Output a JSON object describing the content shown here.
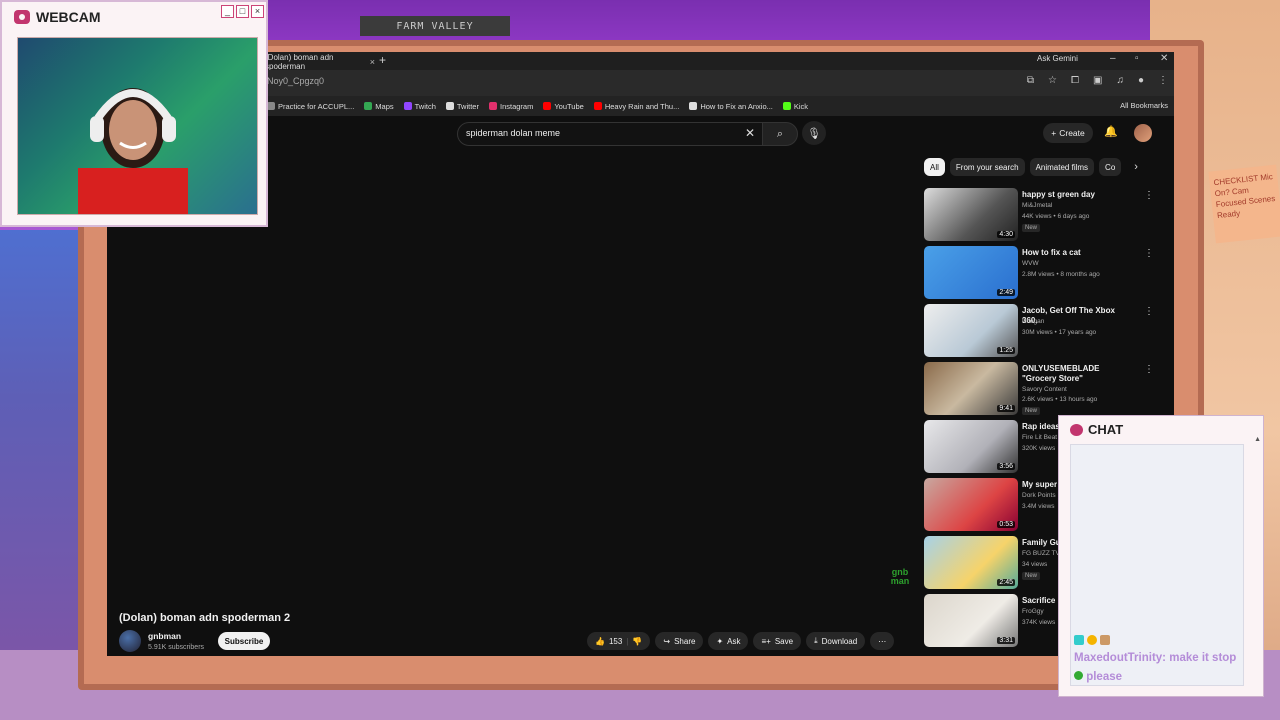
{
  "scene": {
    "shelf_sign": "FARM VALLEY",
    "sticky_note": "CHECKLIST Mic On? Cam Focused Scenes Ready"
  },
  "browser": {
    "tab_title": "(Dolan) boman adn spoderman",
    "tab_close": "×",
    "new_tab": "+",
    "ask_gemini": "Ask Gemini",
    "url": "Noy0_Cpgzq0",
    "bookmarks": [
      {
        "label": "Practice for ACCUPL...",
        "color": "#888888"
      },
      {
        "label": "Maps",
        "color": "#34a853"
      },
      {
        "label": "Twitch",
        "color": "#9146ff"
      },
      {
        "label": "Twitter",
        "color": "#dddddd"
      },
      {
        "label": "Instagram",
        "color": "#e1306c"
      },
      {
        "label": "YouTube",
        "color": "#ff0000"
      },
      {
        "label": "Heavy Rain and Thu...",
        "color": "#ff0000"
      },
      {
        "label": "How to Fix an Anxio...",
        "color": "#dddddd"
      },
      {
        "label": "Kick",
        "color": "#53fc18"
      }
    ],
    "all_bookmarks": "All Bookmarks"
  },
  "youtube": {
    "search_value": "spiderman dolan meme",
    "create_label": "Create",
    "watermark": "gnb man",
    "video": {
      "title": "(Dolan) boman adn spoderman 2",
      "channel": "gnbman",
      "subscribers": "5.91K subscribers",
      "subscribe_label": "Subscribe",
      "likes": "153",
      "share_label": "Share",
      "ask_label": "Ask",
      "save_label": "Save",
      "download_label": "Download"
    },
    "chips": [
      "All",
      "From your search",
      "Animated films",
      "Co"
    ],
    "recommendations": [
      {
        "title": "happy st green day",
        "channel": "Mi&Jmetal",
        "meta": "44K views • 6 days ago",
        "badge": "New",
        "duration": "4:30"
      },
      {
        "title": "How to fix a cat",
        "channel": "WVW",
        "meta": "2.8M views • 8 months ago",
        "badge": "",
        "duration": "2:49"
      },
      {
        "title": "Jacob, Get Off The Xbox 360.",
        "channel": "lilhagan",
        "meta": "30M views • 17 years ago",
        "badge": "",
        "duration": "1:25"
      },
      {
        "title": "ONLYUSEMEBLADE \"Grocery Store\"",
        "channel": "Savory Content",
        "meta": "2.6K views • 13 hours ago",
        "badge": "New",
        "duration": "9:41"
      },
      {
        "title": "Rap ideas",
        "channel": "Fire Lit Beat",
        "meta": "320K views",
        "badge": "",
        "duration": "3:56"
      },
      {
        "title": "My super",
        "channel": "Dork Points",
        "meta": "3.4M views",
        "badge": "",
        "duration": "0:53"
      },
      {
        "title": "Family Gu Moments",
        "channel": "FG BUZZ TV",
        "meta": "34 views",
        "badge": "New",
        "duration": "2:45"
      },
      {
        "title": "Sacrifice",
        "channel": "FroGgy",
        "meta": "374K views",
        "badge": "",
        "duration": "3:31"
      }
    ]
  },
  "webcam": {
    "title": "WEBCAM",
    "controls": [
      "_",
      "□",
      "×"
    ]
  },
  "chat": {
    "title": "CHAT",
    "username": "MaxedoutTrinity:",
    "message": "make it stop",
    "message_end": "please"
  },
  "colors": {
    "accent": "#c2356e",
    "chat_name": "#b48cd8",
    "yt_bg": "#0f0f0f"
  }
}
